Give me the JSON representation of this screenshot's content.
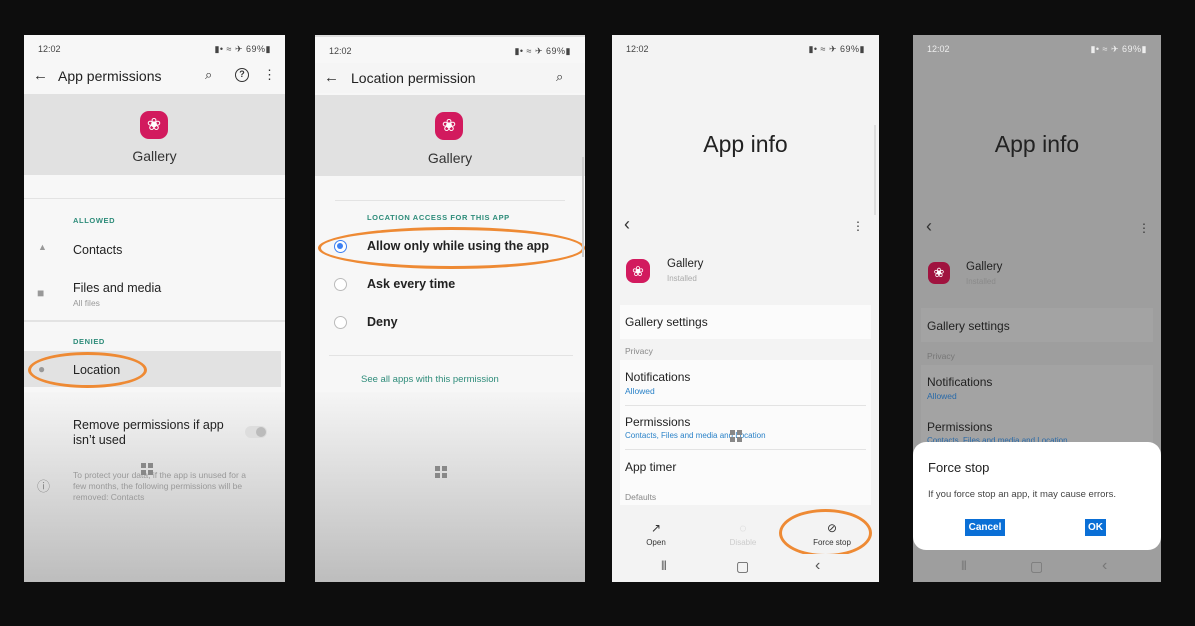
{
  "status_bar": {
    "time": "12:02",
    "icons": "▮• ≈ ✈ 69%▮"
  },
  "annotation_color": "#ee8a34",
  "app": {
    "name": "Gallery",
    "icon": "❀",
    "icon_color": "#d21a5e"
  },
  "screen1": {
    "title": "App permissions",
    "back_icon": "←",
    "search_icon": "⌕",
    "help_icon": "?",
    "more_icon": "⋮",
    "allowed_label": "ALLOWED",
    "allowed": [
      {
        "icon": "▲",
        "label": "Contacts",
        "sub": ""
      },
      {
        "icon": "■",
        "label": "Files and media",
        "sub": "All files"
      }
    ],
    "denied_label": "DENIED",
    "denied": [
      {
        "icon": "●",
        "label": "Location"
      }
    ],
    "remove_perms_line1": "Remove permissions if app",
    "remove_perms_line2": "isn’t used",
    "remove_perms_enabled": false,
    "info_icon": "ⓘ",
    "info_line1": "To protect your data, if the app is unused for a",
    "info_line2": "few months, the following permissions will be",
    "info_line3": "removed: Contacts"
  },
  "screen2": {
    "title": "Location permission",
    "back_icon": "←",
    "search_icon": "⌕",
    "section_label": "LOCATION ACCESS FOR THIS APP",
    "options": [
      {
        "label": "Allow only while using the app",
        "selected": true
      },
      {
        "label": "Ask every time",
        "selected": false
      },
      {
        "label": "Deny",
        "selected": false
      }
    ],
    "see_all_link": "See all apps with this permission"
  },
  "screen3": {
    "big_title": "App info",
    "back_icon": "‹",
    "more_icon": "⋮",
    "app_status": "Installed",
    "gallery_settings": "Gallery settings",
    "privacy_label": "Privacy",
    "notifications": {
      "label": "Notifications",
      "sub": "Allowed"
    },
    "permissions": {
      "label": "Permissions",
      "sub": "Contacts, Files and media and Location"
    },
    "app_timer": "App timer",
    "defaults_label": "Defaults",
    "actions": [
      {
        "icon": "↗",
        "label": "Open",
        "enabled": true
      },
      {
        "icon": "◌",
        "label": "Disable",
        "enabled": false
      },
      {
        "icon": "⊘",
        "label": "Force stop",
        "enabled": true
      }
    ],
    "nav": {
      "recents": "|||",
      "home": "▢",
      "back": "‹"
    }
  },
  "screen4": {
    "big_title": "App info",
    "back_icon": "‹",
    "more_icon": "⋮",
    "app_status": "Installed",
    "gallery_settings": "Gallery settings",
    "privacy_label": "Privacy",
    "notifications": {
      "label": "Notifications",
      "sub": "Allowed"
    },
    "permissions": {
      "label": "Permissions",
      "sub": "Contacts, Files and media and Location"
    },
    "dialog": {
      "title": "Force stop",
      "message": "If you force stop an app, it may cause errors.",
      "cancel": "Cancel",
      "ok": "OK"
    },
    "nav": {
      "recents": "|||",
      "home": "▢",
      "back": "‹"
    }
  }
}
